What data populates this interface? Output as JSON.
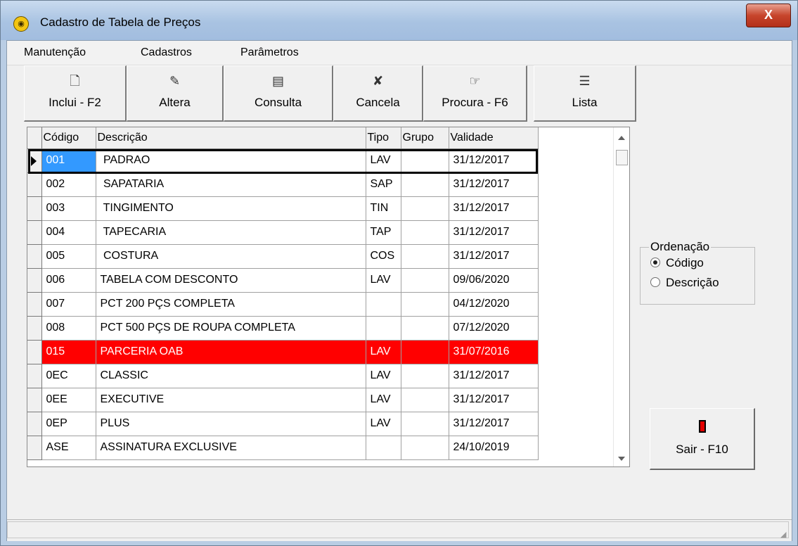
{
  "window": {
    "title": "Cadastro de Tabela de Preços",
    "close_label": "X"
  },
  "menu": [
    "Manutenção",
    "Cadastros",
    "Parâmetros"
  ],
  "toolbar": [
    {
      "label": "Inclui - F2",
      "icon": "new-document-icon"
    },
    {
      "label": "Altera",
      "icon": "edit-document-icon"
    },
    {
      "label": "Consulta",
      "icon": "view-document-icon"
    },
    {
      "label": "Cancela",
      "icon": "cancel-icon"
    },
    {
      "label": "Procura - F6",
      "icon": "pointing-hand-icon"
    },
    {
      "label": "Lista",
      "icon": "list-document-icon"
    }
  ],
  "grid": {
    "columns": [
      "Código",
      "Descrição",
      "Tipo",
      "Grupo",
      "Validade"
    ],
    "rows": [
      {
        "codigo": "001",
        "descricao": " PADRAO",
        "tipo": "LAV",
        "grupo": "",
        "validade": "31/12/2017"
      },
      {
        "codigo": "002",
        "descricao": " SAPATARIA",
        "tipo": "SAP",
        "grupo": "",
        "validade": "31/12/2017"
      },
      {
        "codigo": "003",
        "descricao": " TINGIMENTO",
        "tipo": "TIN",
        "grupo": "",
        "validade": "31/12/2017"
      },
      {
        "codigo": "004",
        "descricao": " TAPECARIA",
        "tipo": "TAP",
        "grupo": "",
        "validade": "31/12/2017"
      },
      {
        "codigo": "005",
        "descricao": " COSTURA",
        "tipo": "COS",
        "grupo": "",
        "validade": "31/12/2017"
      },
      {
        "codigo": "006",
        "descricao": "TABELA COM DESCONTO",
        "tipo": "LAV",
        "grupo": "",
        "validade": "09/06/2020"
      },
      {
        "codigo": "007",
        "descricao": "PCT 200 PÇS COMPLETA",
        "tipo": "",
        "grupo": "",
        "validade": "04/12/2020"
      },
      {
        "codigo": "008",
        "descricao": "PCT 500 PÇS DE ROUPA COMPLETA",
        "tipo": "",
        "grupo": "",
        "validade": "07/12/2020"
      },
      {
        "codigo": "015",
        "descricao": "PARCERIA OAB",
        "tipo": "LAV",
        "grupo": "",
        "validade": "31/07/2016"
      },
      {
        "codigo": "0EC",
        "descricao": "CLASSIC",
        "tipo": "LAV",
        "grupo": "",
        "validade": "31/12/2017"
      },
      {
        "codigo": "0EE",
        "descricao": "EXECUTIVE",
        "tipo": "LAV",
        "grupo": "",
        "validade": "31/12/2017"
      },
      {
        "codigo": "0EP",
        "descricao": "PLUS",
        "tipo": "LAV",
        "grupo": "",
        "validade": "31/12/2017"
      },
      {
        "codigo": "ASE",
        "descricao": "ASSINATURA EXCLUSIVE",
        "tipo": "",
        "grupo": "",
        "validade": "24/10/2019"
      }
    ],
    "selected_index": 0,
    "highlight_index": 8,
    "highlight_color": "#ff0000",
    "selection_color": "#3399ff"
  },
  "ordenacao": {
    "title": "Ordenação",
    "options": [
      "Código",
      "Descrição"
    ],
    "selected": 0
  },
  "sair": {
    "label": "Sair - F10"
  }
}
